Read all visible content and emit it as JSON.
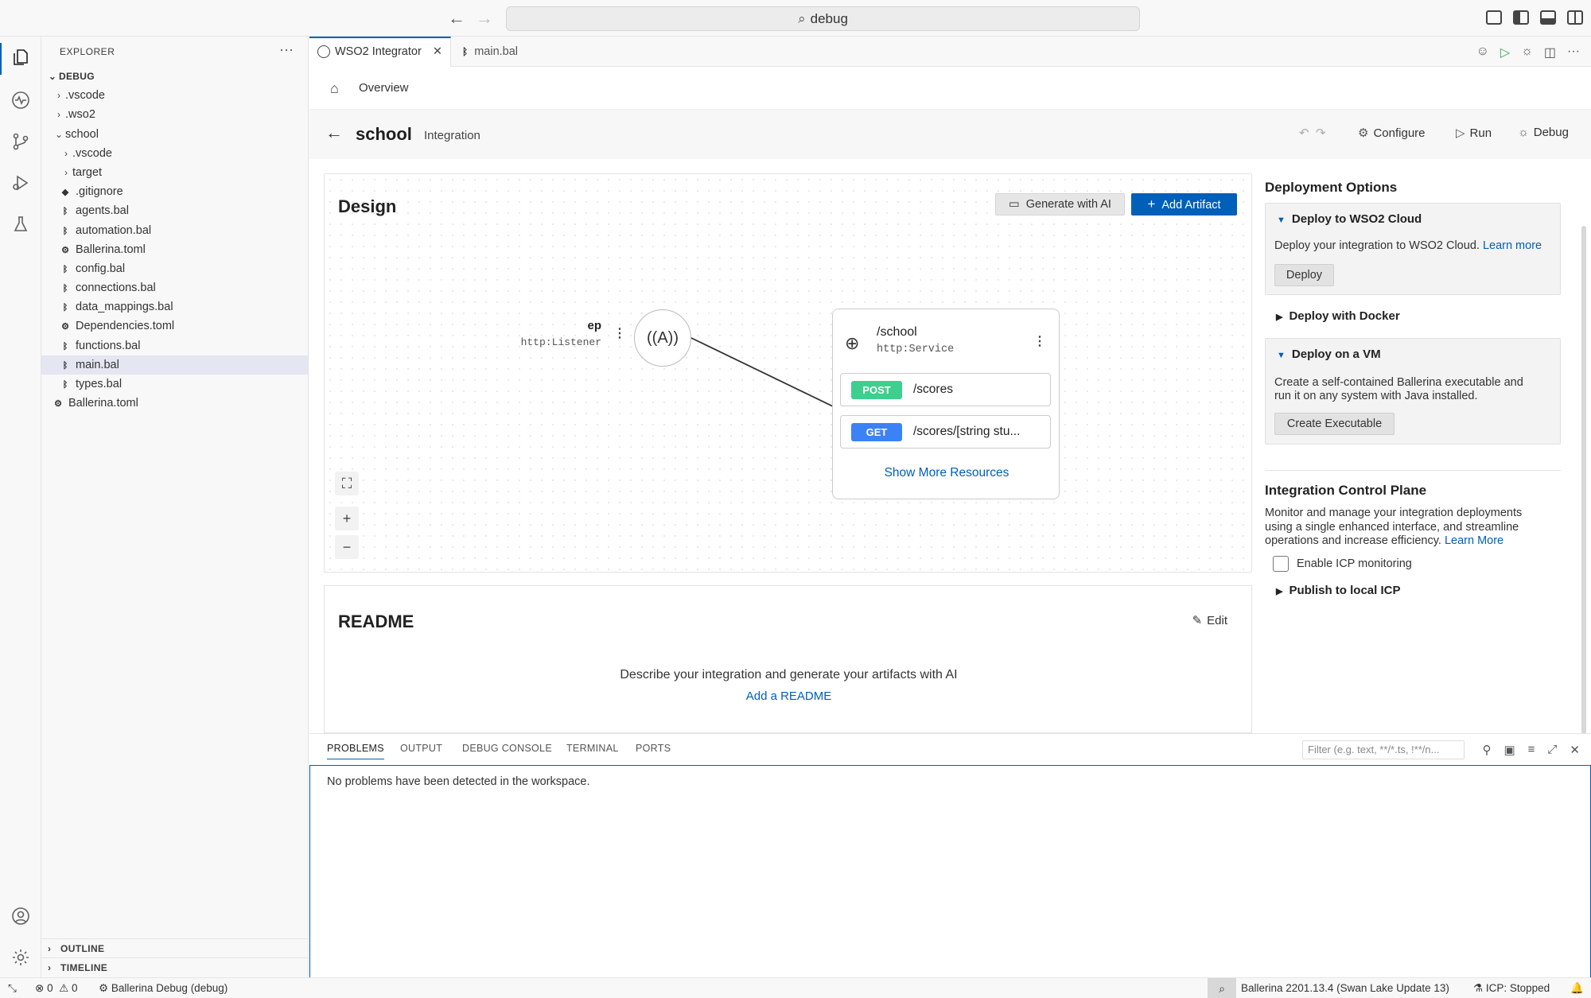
{
  "titlebar": {
    "search_text": "debug"
  },
  "explorer": {
    "title": "EXPLORER",
    "root": "DEBUG",
    "items": [
      {
        "label": ".vscode",
        "kind": "folder",
        "depth": 1,
        "open": false
      },
      {
        "label": ".wso2",
        "kind": "folder",
        "depth": 1,
        "open": false
      },
      {
        "label": "school",
        "kind": "folder",
        "depth": 1,
        "open": true
      },
      {
        "label": ".vscode",
        "kind": "folder",
        "depth": 2,
        "open": false
      },
      {
        "label": "target",
        "kind": "folder",
        "depth": 2,
        "open": false
      },
      {
        "label": ".gitignore",
        "kind": "git",
        "depth": 2
      },
      {
        "label": "agents.bal",
        "kind": "bal",
        "depth": 2
      },
      {
        "label": "automation.bal",
        "kind": "bal",
        "depth": 2
      },
      {
        "label": "Ballerina.toml",
        "kind": "toml",
        "depth": 2
      },
      {
        "label": "config.bal",
        "kind": "bal",
        "depth": 2
      },
      {
        "label": "connections.bal",
        "kind": "bal",
        "depth": 2
      },
      {
        "label": "data_mappings.bal",
        "kind": "bal",
        "depth": 2
      },
      {
        "label": "Dependencies.toml",
        "kind": "toml",
        "depth": 2
      },
      {
        "label": "functions.bal",
        "kind": "bal",
        "depth": 2
      },
      {
        "label": "main.bal",
        "kind": "bal",
        "depth": 2,
        "selected": true
      },
      {
        "label": "types.bal",
        "kind": "bal",
        "depth": 2
      },
      {
        "label": "Ballerina.toml",
        "kind": "toml",
        "depth": 1
      }
    ],
    "outline": "OUTLINE",
    "timeline": "TIMELINE"
  },
  "tabs": [
    {
      "label": "WSO2 Integrator",
      "active": true
    },
    {
      "label": "main.bal",
      "active": false
    }
  ],
  "editor": {
    "breadcrumb": "Overview",
    "title": "school",
    "subtitle": "Integration",
    "actions": {
      "configure": "Configure",
      "run": "Run",
      "debug": "Debug"
    }
  },
  "design": {
    "title": "Design",
    "generate_ai": "Generate with AI",
    "add_artifact": "Add Artifact",
    "listener": {
      "name": "ep",
      "type": "http:Listener"
    },
    "service": {
      "path": "/school",
      "type": "http:Service",
      "resources": [
        {
          "method": "POST",
          "path": "/scores",
          "color": "#3ecf8e"
        },
        {
          "method": "GET",
          "path": "/scores/[string stu...",
          "color": "#3b82f6"
        }
      ],
      "show_more": "Show More Resources"
    }
  },
  "readme": {
    "title": "README",
    "edit": "Edit",
    "description": "Describe your integration and generate your artifacts with AI",
    "add": "Add a README"
  },
  "deployment": {
    "title": "Deployment Options",
    "wso2_cloud": {
      "title": "Deploy to WSO2 Cloud",
      "desc": "Deploy your integration to WSO2 Cloud.",
      "learn_more": "Learn more",
      "button": "Deploy"
    },
    "docker": {
      "title": "Deploy with Docker"
    },
    "vm": {
      "title": "Deploy on a VM",
      "desc1": "Create a self-contained Ballerina executable and",
      "desc2": "run it on any system with Java installed.",
      "button": "Create Executable"
    }
  },
  "icp": {
    "title": "Integration Control Plane",
    "desc1": "Monitor and manage your integration deployments",
    "desc2": "using a single enhanced interface, and streamline",
    "desc3": "operations and increase efficiency.",
    "learn_more": "Learn More",
    "checkbox": "Enable ICP monitoring",
    "publish": "Publish to local ICP"
  },
  "panel": {
    "tabs": [
      "PROBLEMS",
      "OUTPUT",
      "DEBUG CONSOLE",
      "TERMINAL",
      "PORTS"
    ],
    "filter_placeholder": "Filter (e.g. text, **/*.ts, !**/n...",
    "message": "No problems have been detected in the workspace."
  },
  "statusbar": {
    "errors": "0",
    "warnings": "0",
    "debug_target": "Ballerina Debug (debug)",
    "version": "Ballerina 2201.13.4 (Swan Lake Update 13)",
    "icp_status": "ICP: Stopped"
  }
}
